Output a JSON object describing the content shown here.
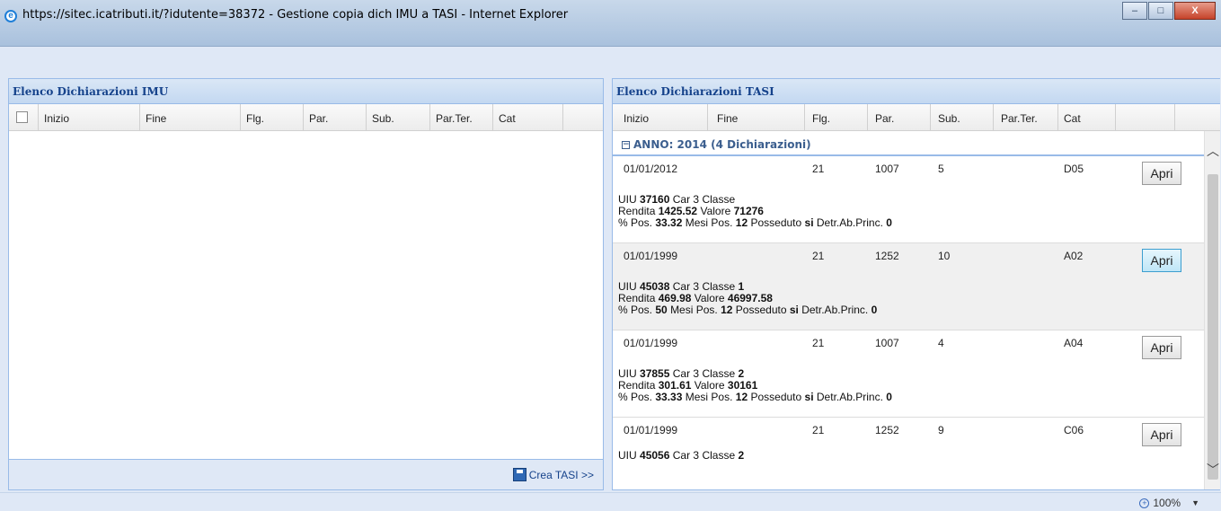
{
  "window": {
    "title": "https://sitec.icatributi.it/?idutente=38372 - Gestione copia dich IMU a TASI - Internet Explorer",
    "min": "–",
    "max": "□",
    "close": "X"
  },
  "left_panel": {
    "title": "Elenco Dichiarazioni IMU",
    "columns": [
      "Inizio",
      "Fine",
      "Flg.",
      "Par.",
      "Sub.",
      "Par.Ter.",
      "Cat"
    ],
    "create_button": "Crea TASI >>"
  },
  "right_panel": {
    "title": "Elenco Dichiarazioni TASI",
    "columns": [
      "Inizio",
      "Fine",
      "Flg.",
      "Par.",
      "Sub.",
      "Par.Ter.",
      "Cat"
    ],
    "group_label": "ANNO: 2014 (4 Dichiarazioni)",
    "records": [
      {
        "inizio": "01/01/2012",
        "fine": "",
        "flg": "21",
        "par": "1007",
        "sub": "5",
        "parter": "",
        "cat": "D05",
        "button": "Apri",
        "uiu": "37160",
        "car": "3",
        "classe": "",
        "rendita": "1425.52",
        "valore": "71276",
        "pos": "33.32",
        "mesi": "12",
        "posseduto": "si",
        "detr": "0"
      },
      {
        "inizio": "01/01/1999",
        "fine": "",
        "flg": "21",
        "par": "1252",
        "sub": "10",
        "parter": "",
        "cat": "A02",
        "button": "Apri",
        "uiu": "45038",
        "car": "3",
        "classe": "1",
        "rendita": "469.98",
        "valore": "46997.58",
        "pos": "50",
        "mesi": "12",
        "posseduto": "si",
        "detr": "0"
      },
      {
        "inizio": "01/01/1999",
        "fine": "",
        "flg": "21",
        "par": "1007",
        "sub": "4",
        "parter": "",
        "cat": "A04",
        "button": "Apri",
        "uiu": "37855",
        "car": "3",
        "classe": "2",
        "rendita": "301.61",
        "valore": "30161",
        "pos": "33.33",
        "mesi": "12",
        "posseduto": "si",
        "detr": "0"
      },
      {
        "inizio": "01/01/1999",
        "fine": "",
        "flg": "21",
        "par": "1252",
        "sub": "9",
        "parter": "",
        "cat": "C06",
        "button": "Apri",
        "uiu": "45056",
        "car": "3",
        "classe": "2",
        "rendita": "",
        "valore": "",
        "pos": "",
        "mesi": "",
        "posseduto": "",
        "detr": ""
      }
    ]
  },
  "labels": {
    "uiu": "UIU",
    "car": "Car",
    "classe": "Classe",
    "rendita": "Rendita",
    "valore": "Valore",
    "pos": "% Pos.",
    "mesi": "Mesi Pos.",
    "posseduto": "Posseduto",
    "detr": "Detr.Ab.Princ."
  },
  "status": {
    "zoom": "100%"
  },
  "colors": {
    "header_text": "#15428b",
    "panel_border": "#99bbe8",
    "hover_button": "#bfe6f7"
  }
}
